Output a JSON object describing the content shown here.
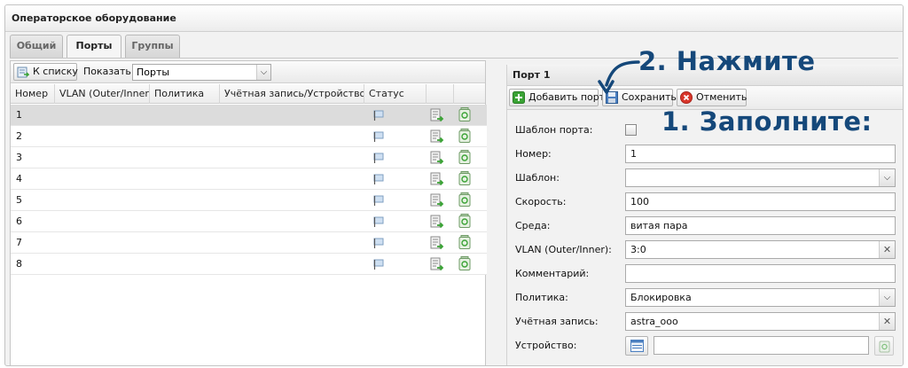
{
  "window": {
    "title": "Операторское оборудование"
  },
  "tabs": [
    {
      "label": "Общий",
      "active": false
    },
    {
      "label": "Порты",
      "active": true
    },
    {
      "label": "Группы",
      "active": false
    }
  ],
  "list_toolbar": {
    "back_label": "К списку",
    "show_label": "Показать:",
    "show_value": "Порты"
  },
  "grid": {
    "columns": [
      "Номер",
      "VLAN (Outer/Inner)",
      "Политика",
      "Учётная запись/Устройство",
      "Статус"
    ],
    "rows": [
      {
        "num": "1"
      },
      {
        "num": "2"
      },
      {
        "num": "3"
      },
      {
        "num": "4"
      },
      {
        "num": "5"
      },
      {
        "num": "6"
      },
      {
        "num": "7"
      },
      {
        "num": "8"
      }
    ]
  },
  "port_panel": {
    "title": "Порт 1",
    "add_label": "Добавить порт",
    "save_label": "Сохранить",
    "cancel_label": "Отменить",
    "fields": {
      "template_flag": {
        "label": "Шаблон порта:",
        "checked": false
      },
      "number": {
        "label": "Номер:",
        "value": "1"
      },
      "template": {
        "label": "Шаблон:",
        "value": ""
      },
      "speed": {
        "label": "Скорость:",
        "value": "100"
      },
      "medium": {
        "label": "Среда:",
        "value": "витая пара"
      },
      "vlan": {
        "label": "VLAN (Outer/Inner):",
        "value": "3:0"
      },
      "comment": {
        "label": "Комментарий:",
        "value": ""
      },
      "policy": {
        "label": "Политика:",
        "value": "Блокировка"
      },
      "account": {
        "label": "Учётная запись:",
        "value": "astra_ooo"
      },
      "device": {
        "label": "Устройство:",
        "value": ""
      }
    }
  },
  "annotations": {
    "step2": "2. Нажмите",
    "step1": "1. Заполните:"
  },
  "colors": {
    "annotation": "#15487a",
    "add_green": "#3aa335",
    "cancel_red": "#d9362b"
  }
}
